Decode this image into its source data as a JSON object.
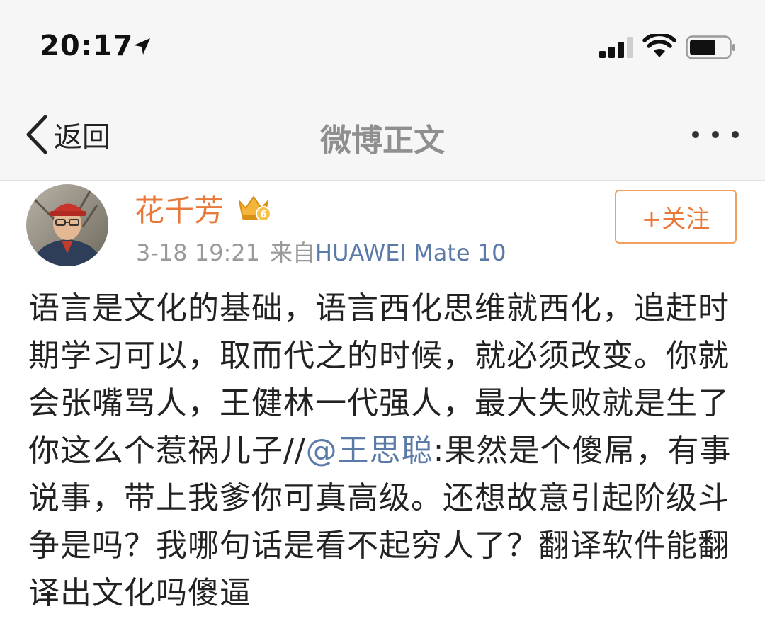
{
  "status_bar": {
    "time": "20:17",
    "icons": [
      "location-arrow-icon",
      "cellular-signal-icon",
      "wifi-icon",
      "battery-icon"
    ]
  },
  "nav": {
    "back_label": "返回",
    "title": "微博正文",
    "more_icon": "more-dots-icon"
  },
  "post": {
    "author": {
      "name": "花千芳",
      "badge_icon": "vip-crown-icon",
      "badge_level": "6"
    },
    "time": "3-18 19:21",
    "source_prefix": "来自",
    "source": "HUAWEI Mate 10",
    "follow_label": "+关注",
    "body": {
      "before_mention": "语言是文化的基础，语言西化思维就西化，追赶时期学习可以，取而代之的时候，就必须改变。你就会张嘴骂人，王健林一代强人，最大失败就是生了你这么个惹祸儿子//",
      "mention": "@王思聪",
      "after_mention": ":果然是个傻屌，有事说事，带上我爹你可真高级。还想故意引起阶级斗争是吗？我哪句话是看不起穷人了？翻译软件能翻译出文化吗傻逼"
    }
  },
  "colors": {
    "accent_orange": "#e8793a",
    "link_blue": "#5b7aa8",
    "meta_gray": "#9a9a9a",
    "chrome_bg": "#f6f6f6"
  }
}
